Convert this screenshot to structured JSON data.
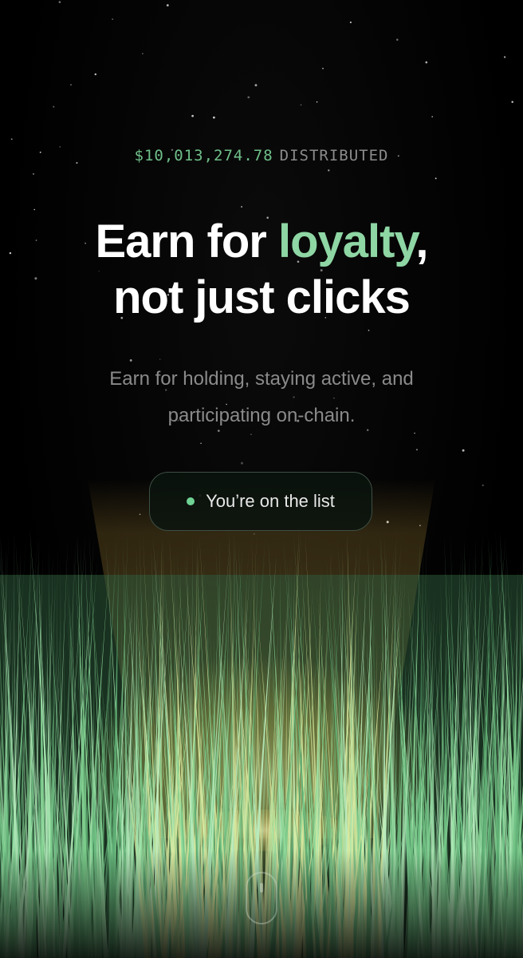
{
  "hero": {
    "stat": {
      "amount": "$10,013,274.78",
      "suffix": "DISTRIBUTED"
    },
    "headline": {
      "part1": "Earn for ",
      "accent": "loyalty",
      "part2": ",",
      "line2": "not just clicks"
    },
    "subhead": "Earn for holding, staying active, and participating on-chain."
  },
  "status": {
    "label": "You’re on the list"
  },
  "colors": {
    "background": "#000000",
    "accent_green": "#8ed6a4",
    "amount_green": "#6fbf89",
    "status_dot": "#6fd394",
    "muted_text": "#8a8a8a",
    "glow_yellow": "#f3d36a",
    "grass_green": "#7fcf8f"
  },
  "icons": {
    "status": "status-dot-icon",
    "scroll": "mouse-scroll-icon"
  }
}
